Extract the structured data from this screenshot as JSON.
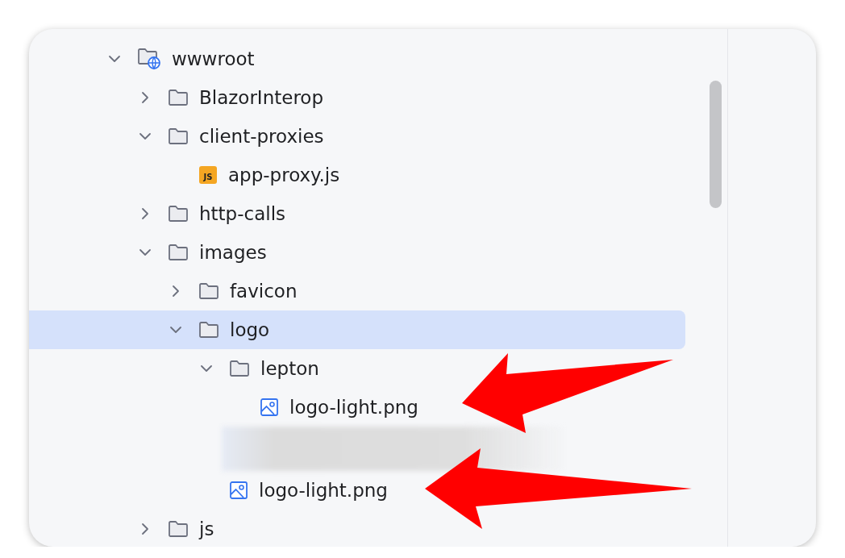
{
  "tree": [
    {
      "label": "wwwroot",
      "kind": "web-folder",
      "expanded": true,
      "selected": false,
      "children": [
        {
          "label": "BlazorInterop",
          "kind": "folder",
          "expanded": false,
          "selected": false
        },
        {
          "label": "client-proxies",
          "kind": "folder",
          "expanded": true,
          "selected": false,
          "children": [
            {
              "label": "app-proxy.js",
              "kind": "js",
              "selected": false,
              "icon_text": "JS"
            }
          ]
        },
        {
          "label": "http-calls",
          "kind": "folder",
          "expanded": false,
          "selected": false
        },
        {
          "label": "images",
          "kind": "folder",
          "expanded": true,
          "selected": false,
          "children": [
            {
              "label": "favicon",
              "kind": "folder",
              "expanded": false,
              "selected": false
            },
            {
              "label": "logo",
              "kind": "folder",
              "expanded": true,
              "selected": true,
              "children": [
                {
                  "label": "lepton",
                  "kind": "folder",
                  "expanded": true,
                  "selected": false,
                  "children": [
                    {
                      "label": "logo-light.png",
                      "kind": "image",
                      "selected": false
                    }
                  ]
                },
                {
                  "kind": "redacted"
                },
                {
                  "label": "logo-light.png",
                  "kind": "image",
                  "selected": false
                }
              ]
            }
          ]
        },
        {
          "label": "js",
          "kind": "folder",
          "expanded": false,
          "selected": false
        }
      ]
    }
  ]
}
